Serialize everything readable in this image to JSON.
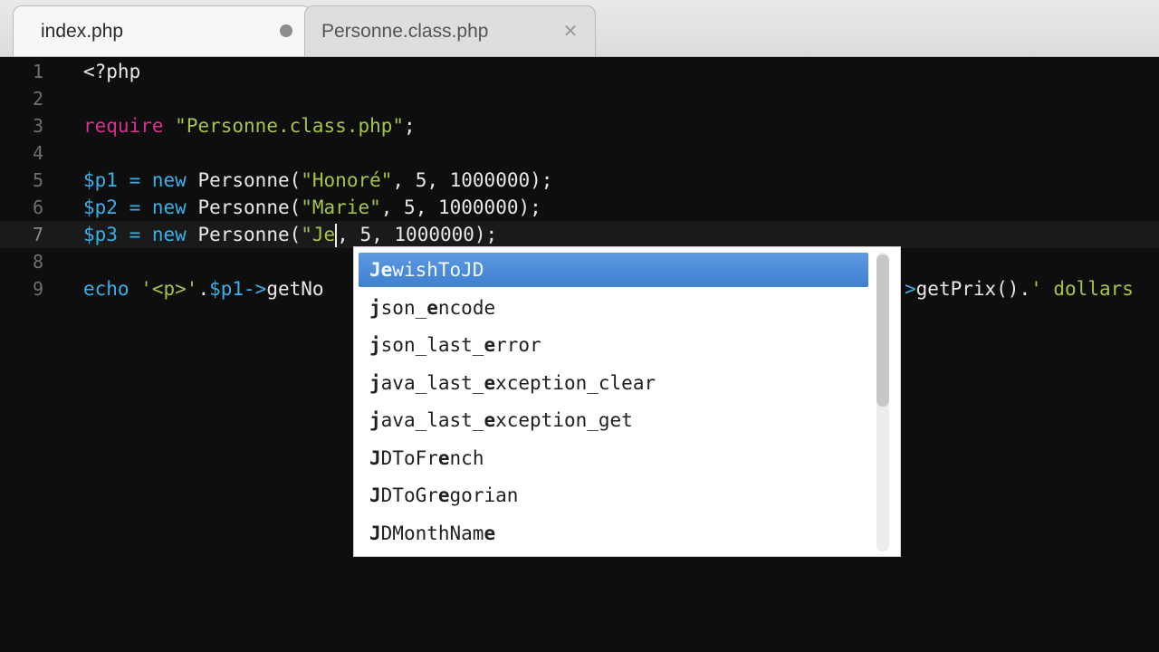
{
  "tabs": [
    {
      "label": "index.php",
      "active": true,
      "modified": true
    },
    {
      "label": "Personne.class.php",
      "active": false,
      "modified": false
    }
  ],
  "close_glyph": "✕",
  "line_numbers": [
    "1",
    "2",
    "3",
    "4",
    "5",
    "6",
    "7",
    "8",
    "9"
  ],
  "code": {
    "line1": "<?php",
    "line3_kw": "require",
    "line3_str": "\"Personne.class.php\"",
    "line3_end": ";",
    "line5_var": "$p1",
    "line5_eq": " = ",
    "line5_new": "new",
    "line5_cls": " Personne(",
    "line5_str": "\"Honoré\"",
    "line5_rest": ", 5, 1000000);",
    "line6_var": "$p2",
    "line6_eq": " = ",
    "line6_new": "new",
    "line6_cls": " Personne(",
    "line6_str": "\"Marie\"",
    "line6_rest": ", 5, 1000000);",
    "line7_var": "$p3",
    "line7_eq": " = ",
    "line7_new": "new",
    "line7_cls": " Personne(",
    "line7_str": "\"Je",
    "line7_rest": ", 5, 1000000);",
    "line9_echo": "echo",
    "line9_str": " '<p>'",
    "line9_dot": ".",
    "line9_var": "$p1",
    "line9_arrow": "->",
    "line9_call": "getNo",
    "line9_tail_arrow": ">",
    "line9_tail_call": "getPrix()",
    "line9_tail_dot": ".",
    "line9_tail_str": "' dollars"
  },
  "autocomplete": {
    "items": [
      {
        "bold": "Je",
        "rest": "wishToJD",
        "selected": true
      },
      {
        "html": "<b>j</b>son_<b>e</b>ncode",
        "selected": false
      },
      {
        "html": "<b>j</b>son_last_<b>e</b>rror",
        "selected": false
      },
      {
        "html": "<b>j</b>ava_last_<b>e</b>xception_clear",
        "selected": false
      },
      {
        "html": "<b>j</b>ava_last_<b>e</b>xception_get",
        "selected": false
      },
      {
        "html": "<b>J</b>DToFr<b>e</b>nch",
        "selected": false
      },
      {
        "html": "<b>J</b>DToGr<b>e</b>gorian",
        "selected": false
      },
      {
        "html": "<b>J</b>DMonthNam<b>e</b>",
        "selected": false
      }
    ]
  },
  "colors": {
    "background": "#0e0e0e",
    "keyword": "#d8318f",
    "string": "#a3c64a",
    "variable": "#3bb0e8",
    "selection": "#4a8bdc"
  }
}
